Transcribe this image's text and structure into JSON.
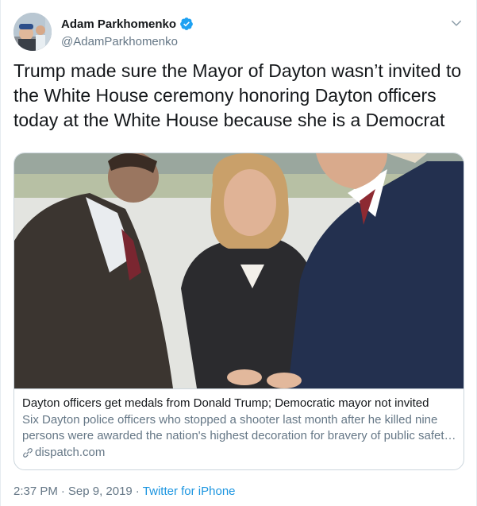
{
  "author": {
    "display_name": "Adam Parkhomenko",
    "handle": "@AdamParkhomenko",
    "verified": true
  },
  "icons": {
    "verified": "verified-badge-icon",
    "menu": "chevron-down-icon",
    "link": "link-icon"
  },
  "tweet": {
    "text": "Trump made sure the Mayor of Dayton wasn’t invited to the White House ceremony honoring Dayton officers today at the White House because she is a Democrat"
  },
  "card": {
    "title": "Dayton officers get medals from Donald Trump; Democratic mayor not invited",
    "description_line1": "Six Dayton police officers who stopped a shooter last month after he killed nine",
    "description_line2": "persons were awarded the nation's highest decoration for bravery of public safet…",
    "domain": "dispatch.com"
  },
  "meta": {
    "time": "2:37 PM",
    "date": "Sep 9, 2019",
    "separator": "·",
    "source": "Twitter for iPhone"
  },
  "colors": {
    "accent": "#1da1f2",
    "link": "#1b95e0",
    "secondary_text": "#657786",
    "border": "#ccd6dd"
  }
}
